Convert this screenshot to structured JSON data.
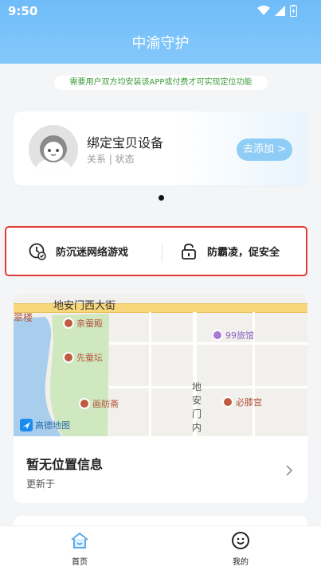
{
  "status_bar": {
    "time": "9:50"
  },
  "header": {
    "title": "中渝守护"
  },
  "notice": {
    "text": "需要用户双方均安装该APP或付费才可实现定位功能"
  },
  "device_card": {
    "title": "绑定宝贝设备",
    "subtitle": "关系 | 状态",
    "add_button": "去添加 >"
  },
  "features": [
    {
      "label": "防沉迷网络游戏",
      "icon": "clock-check-icon"
    },
    {
      "label": "防霸凌，促安全",
      "icon": "lock-icon"
    }
  ],
  "map": {
    "street_label": "地安门西大街",
    "street_label_vertical": "地安门内",
    "area_label": "翠楼",
    "pois": [
      {
        "name": "亲蚕殿",
        "type": "landmark"
      },
      {
        "name": "先蚕坛",
        "type": "landmark"
      },
      {
        "name": "画舫斋",
        "type": "landmark"
      },
      {
        "name": "99旅馆",
        "type": "hotel"
      },
      {
        "name": "必膝宫",
        "type": "landmark"
      }
    ],
    "logo": "高德地图"
  },
  "location": {
    "title": "暂无位置信息",
    "updated_label": "更新于"
  },
  "tabbar": {
    "tabs": [
      {
        "label": "首页",
        "icon": "home-icon",
        "active": true
      },
      {
        "label": "我的",
        "icon": "smile-icon",
        "active": false
      }
    ]
  },
  "colors": {
    "header": "#6fbcf8",
    "accent": "#8fcdf6",
    "highlight_border": "#e23a3a"
  }
}
